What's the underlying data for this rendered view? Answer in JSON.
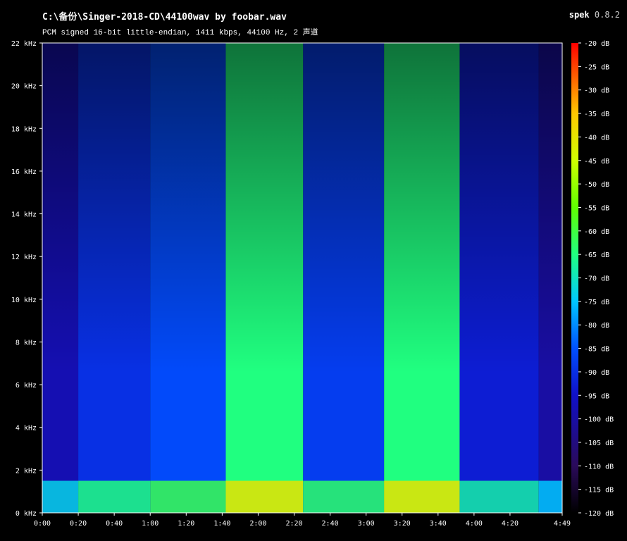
{
  "header": {
    "title": "C:\\备份\\Singer-2018-CD\\44100wav by foobar.wav",
    "subtitle": "PCM signed 16-bit little-endian, 1411 kbps, 44100 Hz, 2 声道",
    "app_name": "spek",
    "app_version": "0.8.2"
  },
  "chart_data": {
    "type": "heatmap",
    "title": "C:\\备份\\Singer-2018-CD\\44100wav by foobar.wav",
    "xlabel": "",
    "ylabel": "",
    "x_ticks": [
      "0:00",
      "0:20",
      "0:40",
      "1:00",
      "1:20",
      "1:40",
      "2:00",
      "2:20",
      "2:40",
      "3:00",
      "3:20",
      "3:40",
      "4:00",
      "4:20",
      "4:49"
    ],
    "x_tick_seconds": [
      0,
      20,
      40,
      60,
      80,
      100,
      120,
      140,
      160,
      180,
      200,
      220,
      240,
      260,
      289
    ],
    "xlim_seconds": [
      0,
      289
    ],
    "y_ticks": [
      "0 kHz",
      "2 kHz",
      "4 kHz",
      "6 kHz",
      "8 kHz",
      "10 kHz",
      "12 kHz",
      "14 kHz",
      "16 kHz",
      "18 kHz",
      "20 kHz",
      "22 kHz"
    ],
    "y_tick_khz": [
      0,
      2,
      4,
      6,
      8,
      10,
      12,
      14,
      16,
      18,
      20,
      22
    ],
    "ylim_khz": [
      0,
      22
    ],
    "colorbar_ticks": [
      "-20 dB",
      "-25 dB",
      "-30 dB",
      "-35 dB",
      "-40 dB",
      "-45 dB",
      "-50 dB",
      "-55 dB",
      "-60 dB",
      "-65 dB",
      "-70 dB",
      "-75 dB",
      "-80 dB",
      "-85 dB",
      "-90 dB",
      "-95 dB",
      "-100 dB",
      "-105 dB",
      "-110 dB",
      "-115 dB",
      "-120 dB"
    ],
    "colorbar_db": [
      -20,
      -25,
      -30,
      -35,
      -40,
      -45,
      -50,
      -55,
      -60,
      -65,
      -70,
      -75,
      -80,
      -85,
      -90,
      -95,
      -100,
      -105,
      -110,
      -115,
      -120
    ],
    "color_range_db": [
      -120,
      -20
    ],
    "segments": [
      {
        "t0": 0,
        "t1": 20,
        "level_db": -98,
        "top_khz": 22
      },
      {
        "t0": 20,
        "t1": 60,
        "level_db": -90,
        "top_khz": 22
      },
      {
        "t0": 60,
        "t1": 102,
        "level_db": -86,
        "top_khz": 22
      },
      {
        "t0": 102,
        "t1": 145,
        "level_db": -65,
        "top_khz": 22
      },
      {
        "t0": 145,
        "t1": 190,
        "level_db": -88,
        "top_khz": 22
      },
      {
        "t0": 190,
        "t1": 232,
        "level_db": -65,
        "top_khz": 22
      },
      {
        "t0": 232,
        "t1": 276,
        "level_db": -93,
        "top_khz": 22
      },
      {
        "t0": 276,
        "t1": 289,
        "level_db": -100,
        "top_khz": 22
      }
    ],
    "grid": false
  }
}
